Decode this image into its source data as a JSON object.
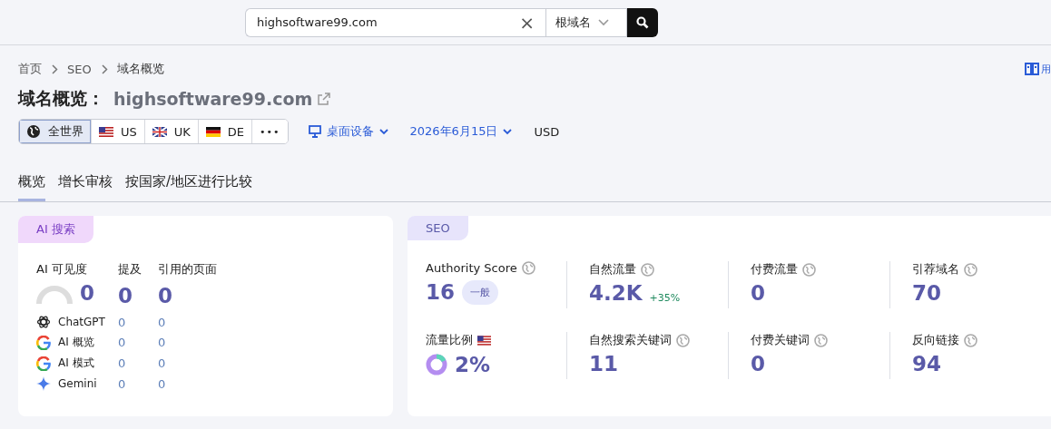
{
  "search": {
    "value": "highsoftware99.com",
    "clear": "×",
    "scope": "根域名"
  },
  "breadcrumb": [
    "首页",
    "SEO",
    "域名概览"
  ],
  "help_link": "用",
  "title": {
    "label": "域名概览：",
    "domain": "highsoftware99.com"
  },
  "regions": [
    {
      "label": "全世界",
      "kind": "world",
      "selected": true
    },
    {
      "label": "US",
      "kind": "us",
      "selected": false
    },
    {
      "label": "UK",
      "kind": "uk",
      "selected": false
    },
    {
      "label": "DE",
      "kind": "de",
      "selected": false
    }
  ],
  "more": "•••",
  "device": "桌面设备",
  "date": "2026年6月15日",
  "currency": "USD",
  "tabs": [
    {
      "label": "概览",
      "selected": true
    },
    {
      "label": "增长审核",
      "selected": false
    },
    {
      "label": "按国家/地区进行比较",
      "selected": false
    }
  ],
  "ai_card": {
    "tag": "AI 搜索",
    "headers": [
      "AI 可见度",
      "提及",
      "引用的页面"
    ],
    "visibility": "0",
    "level": 0,
    "mentions": "0",
    "cited_pages": "0",
    "rows": [
      {
        "name": "ChatGPT",
        "kind": "chatgpt",
        "mentions": "0",
        "cited": "0"
      },
      {
        "name": "AI 概览",
        "kind": "google",
        "mentions": "0",
        "cited": "0"
      },
      {
        "name": "AI 模式",
        "kind": "google",
        "mentions": "0",
        "cited": "0"
      },
      {
        "name": "Gemini",
        "kind": "gemini",
        "mentions": "0",
        "cited": "0"
      }
    ]
  },
  "seo_card": {
    "tag": "SEO",
    "metrics": [
      {
        "label": "Authority Score",
        "value": "16",
        "badge": "一般",
        "kind": "info"
      },
      {
        "label": "自然流量",
        "value": "4.2K",
        "change": "+35%",
        "kind": "info"
      },
      {
        "label": "付费流量",
        "value": "0",
        "kind": "info"
      },
      {
        "label": "引荐域名",
        "value": "70",
        "kind": "info"
      },
      {
        "label": "流量比例",
        "value": "2%",
        "kind": "share"
      },
      {
        "label": "自然搜索关键词",
        "value": "11",
        "kind": "info"
      },
      {
        "label": "付费关键词",
        "value": "0",
        "kind": "info"
      },
      {
        "label": "反向链接",
        "value": "94",
        "kind": "info"
      }
    ]
  }
}
